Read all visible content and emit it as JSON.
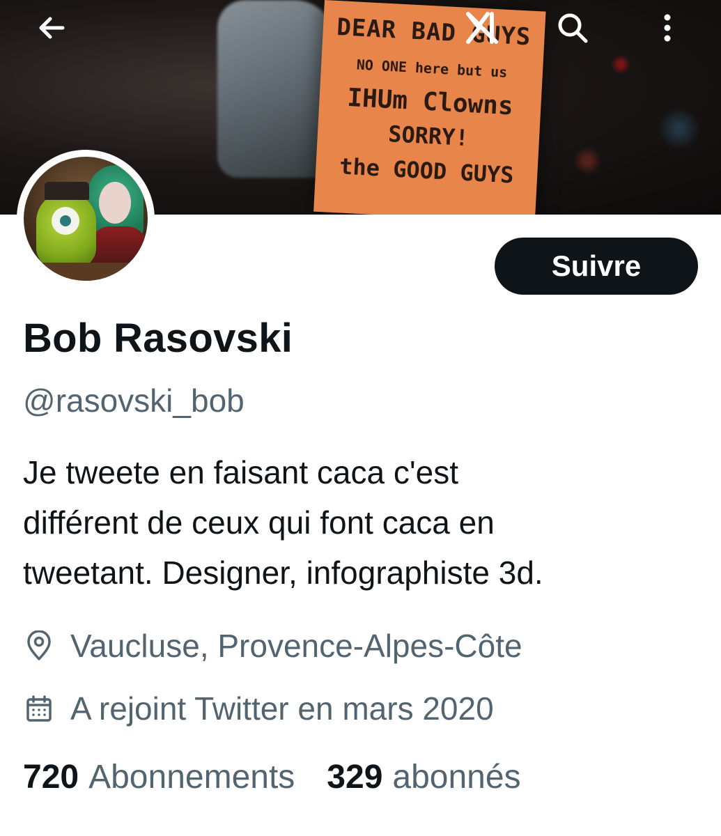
{
  "header": {
    "back_icon": "arrow-left-icon",
    "logo_icon": "x-logo-icon",
    "search_icon": "search-icon",
    "more_icon": "more-vertical-icon",
    "banner_sign": {
      "line1": "DEAR BAD GUYS",
      "line2": "NO ONE here but us",
      "line3": "IHUm Clowns",
      "line4": "SORRY!",
      "line5": "the GOOD GUYS"
    }
  },
  "profile": {
    "name": "Bob Rasovski",
    "handle": "@rasovski_bob",
    "bio_lines": [
      "Je tweete en faisant caca c'est",
      "différent de ceux qui font caca en",
      "tweetant. Designer, infographiste 3d."
    ],
    "location": "Vaucluse, Provence-Alpes-Côte",
    "joined": "A rejoint Twitter en mars 2020",
    "follow_label": "Suivre"
  },
  "stats": {
    "following_count": "720",
    "following_label": "Abonnements",
    "followers_count": "329",
    "followers_label": "abonnés"
  },
  "colors": {
    "text_primary": "#0f1419",
    "text_secondary": "#536471",
    "button_bg": "#0f1419",
    "button_text": "#ffffff",
    "background": "#ffffff"
  }
}
